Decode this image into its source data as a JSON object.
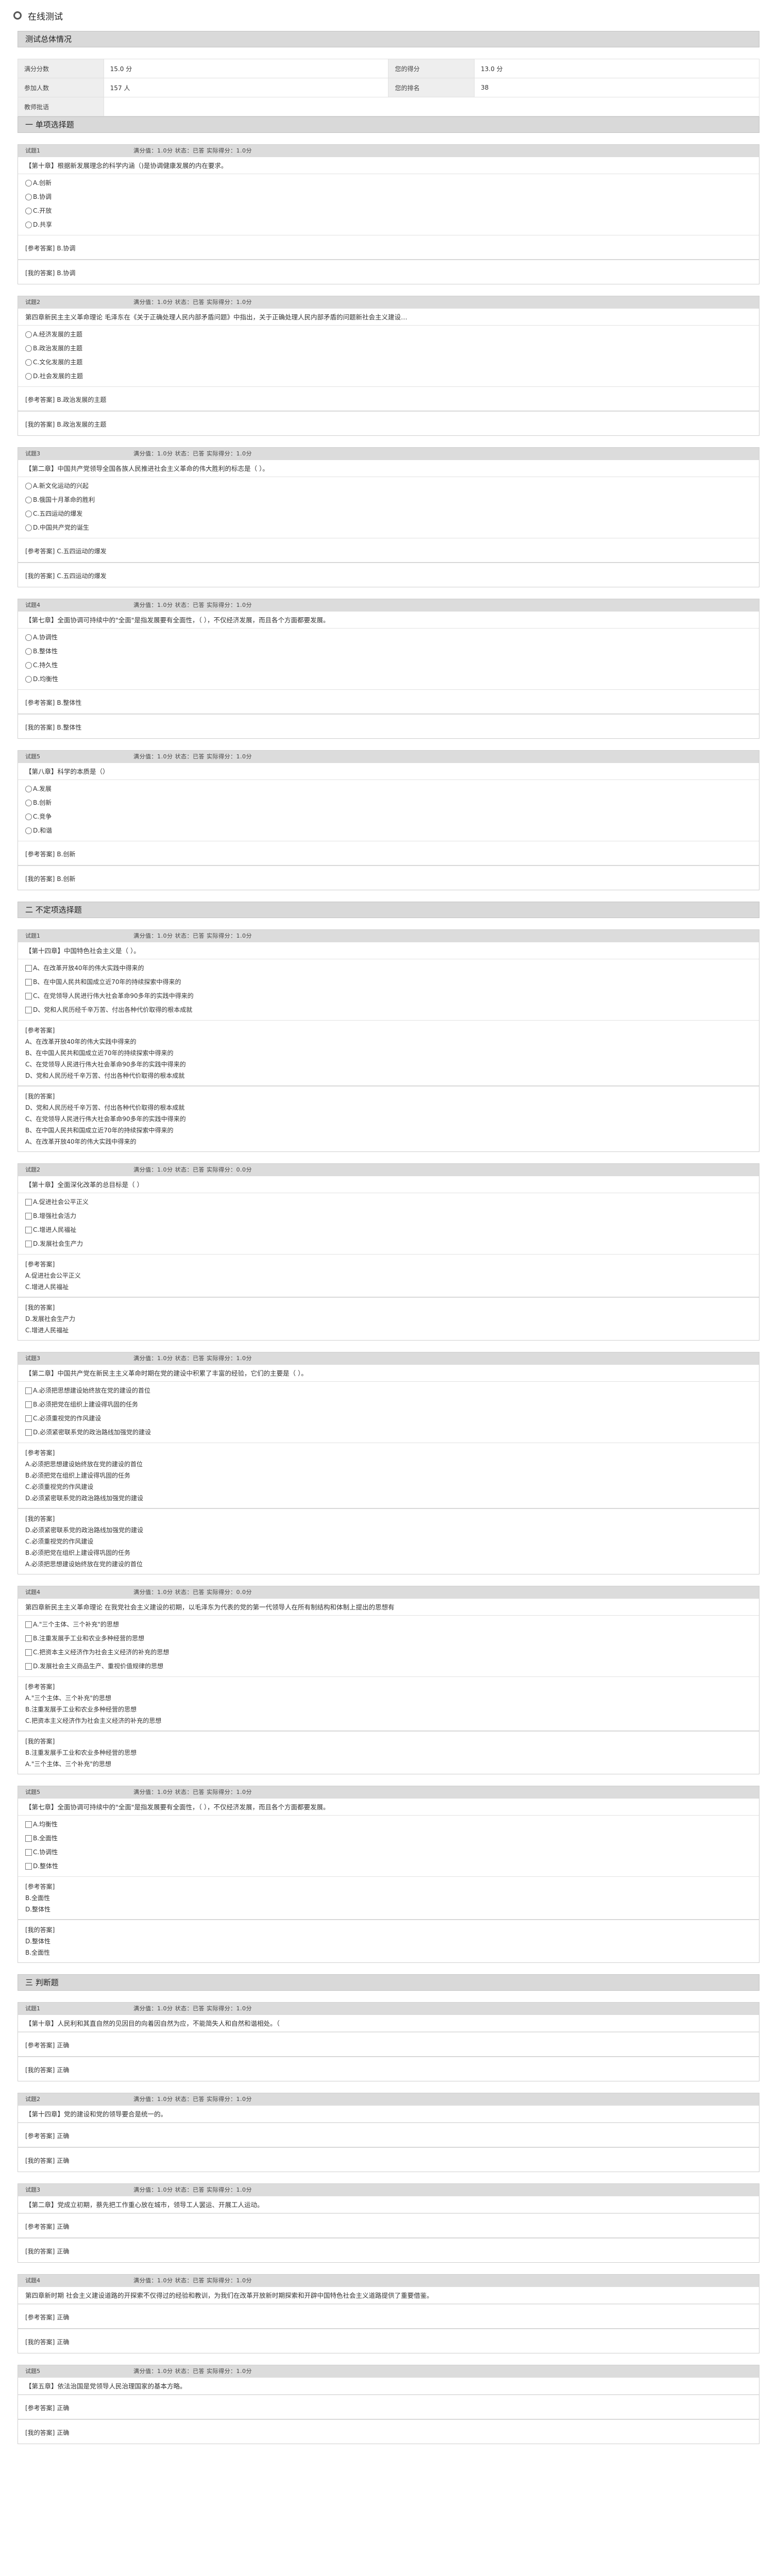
{
  "page_title": "在线测试",
  "summary": {
    "title": "测试总体情况",
    "rows": [
      [
        {
          "k": "满分分数",
          "v": "15.0 分"
        },
        {
          "k": "您的得分",
          "v": "13.0 分"
        }
      ],
      [
        {
          "k": "参加人数",
          "v": "157 人"
        },
        {
          "k": "您的排名",
          "v": "38"
        }
      ],
      [
        {
          "k": "教师批语",
          "v": ""
        }
      ]
    ]
  },
  "labels": {
    "ref": "[参考答案]",
    "mine": "[我的答案]"
  },
  "sections": [
    {
      "title": "一 单项选择题",
      "questions": [
        {
          "no": "试题1",
          "meta": "满分值：1.0分  状态：已答  实际得分：1.0分",
          "text": "【第十章】根据新发展理念的科学内涵（)是协调健康发展的内在要求。",
          "type": "radio",
          "options": [
            "A.创新",
            "B.协调",
            "C.开放",
            "D.共享"
          ],
          "ref": [
            "B.协调"
          ],
          "mine": [
            "B.协调"
          ]
        },
        {
          "no": "试题2",
          "meta": "满分值：1.0分  状态：已答  实际得分：1.0分",
          "text": "第四章新民主主义革命理论 毛泽东在《关于正确处理人民内部矛盾问题》中指出，关于正确处理人民内部矛盾的问题新社会主义建设…",
          "type": "radio",
          "options": [
            "A.经济发展的主题",
            "B.政治发展的主题",
            "C.文化发展的主题",
            "D.社会发展的主题"
          ],
          "ref": [
            "B.政治发展的主题"
          ],
          "mine": [
            "B.政治发展的主题"
          ]
        },
        {
          "no": "试题3",
          "meta": "满分值：1.0分  状态：已答  实际得分：1.0分",
          "text": "【第二章】中国共产党领导全国各族人民推进社会主义革命的伟大胜利的标志是（ ）。",
          "type": "radio",
          "options": [
            "A.新文化运动的兴起",
            "B.俄国十月革命的胜利",
            "C.五四运动的爆发",
            "D.中国共产党的诞生"
          ],
          "ref": [
            "C.五四运动的爆发"
          ],
          "mine": [
            "C.五四运动的爆发"
          ]
        },
        {
          "no": "试题4",
          "meta": "满分值：1.0分  状态：已答  实际得分：1.0分",
          "text": "【第七章】全面协调可持续中的\"全面\"是指发展要有全面性，（ ），不仅经济发展，而且各个方面都要发展。",
          "type": "radio",
          "options": [
            "A.协调性",
            "B.整体性",
            "C.持久性",
            "D.均衡性"
          ],
          "ref": [
            "B.整体性"
          ],
          "mine": [
            "B.整体性"
          ]
        },
        {
          "no": "试题5",
          "meta": "满分值：1.0分  状态：已答  实际得分：1.0分",
          "text": "【第八章】科学的本质是（）",
          "type": "radio",
          "options": [
            "A.发展",
            "B.创新",
            "C.竞争",
            "D.和谐"
          ],
          "ref": [
            "B.创新"
          ],
          "mine": [
            "B.创新"
          ]
        }
      ]
    },
    {
      "title": "二 不定项选择题",
      "questions": [
        {
          "no": "试题1",
          "meta": "满分值：1.0分  状态：已答  实际得分：1.0分",
          "text": "【第十四章】中国特色社会主义是（ ）。",
          "type": "box",
          "options": [
            "A、在改革开放40年的伟大实践中得来的",
            "B、在中国人民共和国成立近70年的持续探索中得来的",
            "C、在党领导人民进行伟大社会革命90多年的实践中得来的",
            "D、党和人民历经千辛万苦、付出各种代价取得的根本成就"
          ],
          "ref": [
            "A、在改革开放40年的伟大实践中得来的",
            "B、在中国人民共和国成立近70年的持续探索中得来的",
            "C、在党领导人民进行伟大社会革命90多年的实践中得来的",
            "D、党和人民历经千辛万苦、付出各种代价取得的根本成就"
          ],
          "mine": [
            "D、党和人民历经千辛万苦、付出各种代价取得的根本成就",
            "C、在党领导人民进行伟大社会革命90多年的实践中得来的",
            "B、在中国人民共和国成立近70年的持续探索中得来的",
            "A、在改革开放40年的伟大实践中得来的"
          ]
        },
        {
          "no": "试题2",
          "meta": "满分值：1.0分  状态：已答  实际得分：0.0分",
          "text": "【第十章】全面深化改革的总目标是（ ）",
          "type": "box",
          "options": [
            "A.促进社会公平正义",
            "B.增强社会活力",
            "C.增进人民福祉",
            "D.发展社会生产力"
          ],
          "ref": [
            "A.促进社会公平正义",
            "C.增进人民福祉"
          ],
          "mine": [
            "D.发展社会生产力",
            "C.增进人民福祉"
          ]
        },
        {
          "no": "试题3",
          "meta": "满分值：1.0分  状态：已答  实际得分：1.0分",
          "text": "【第二章】中国共产党在新民主主义革命时期在党的建设中积累了丰富的经验，它们的主要是（ ）。",
          "type": "box",
          "options": [
            "A.必须把思想建设始终放在党的建设的首位",
            "B.必须把党在组织上建设得巩固的任务",
            "C.必须重视党的作风建设",
            "D.必须紧密联系党的政治路线加强党的建设"
          ],
          "ref": [
            "A.必须把思想建设始终放在党的建设的首位",
            "B.必须把党在组织上建设得巩固的任务",
            "C.必须重视党的作风建设",
            "D.必须紧密联系党的政治路线加强党的建设"
          ],
          "mine": [
            "D.必须紧密联系党的政治路线加强党的建设",
            "C.必须重视党的作风建设",
            "B.必须把党在组织上建设得巩固的任务",
            "A.必须把思想建设始终放在党的建设的首位"
          ]
        },
        {
          "no": "试题4",
          "meta": "满分值：1.0分  状态：已答  实际得分：0.0分",
          "text": "第四章新民主主义革命理论 在我党社会主义建设的初期，以毛泽东为代表的党的第一代领导人在所有制结构和体制上提出的思想有",
          "type": "box",
          "options": [
            "A.\"三个主体、三个补充\"的思想",
            "B.注重发展手工业和农业多种经营的思想",
            "C.把资本主义经济作为社会主义经济的补充的思想",
            "D.发展社会主义商品生产、重视价值规律的思想"
          ],
          "ref": [
            "A.\"三个主体、三个补充\"的思想",
            "B.注重发展手工业和农业多种经营的思想",
            "C.把资本主义经济作为社会主义经济的补充的思想"
          ],
          "mine": [
            "B.注重发展手工业和农业多种经营的思想",
            "A.\"三个主体、三个补充\"的思想"
          ]
        },
        {
          "no": "试题5",
          "meta": "满分值：1.0分  状态：已答  实际得分：1.0分",
          "text": "【第七章】全面协调可持续中的\"全面\"是指发展要有全面性，（ ），不仅经济发展，而且各个方面都要发展。",
          "type": "box",
          "options": [
            "A.均衡性",
            "B.全面性",
            "C.协调性",
            "D.整体性"
          ],
          "ref": [
            "B.全面性",
            "D.整体性"
          ],
          "mine": [
            "D.整体性",
            "B.全面性"
          ]
        }
      ]
    },
    {
      "title": "三 判断题",
      "questions": [
        {
          "no": "试题1",
          "meta": "满分值：1.0分  状态：已答  实际得分：1.0分",
          "text": "【第十章】人民利和其直自然的见因目的向着因自然为应，不能简失人和自然和谐相处。（",
          "type": "none",
          "options": [],
          "ref": [
            "正确"
          ],
          "mine": [
            "正确"
          ]
        },
        {
          "no": "试题2",
          "meta": "满分值：1.0分  状态：已答  实际得分：1.0分",
          "text": "【第十四章】党的建设和党的领导要合是统一的。",
          "type": "none",
          "options": [],
          "ref": [
            "正确"
          ],
          "mine": [
            "正确"
          ]
        },
        {
          "no": "试题3",
          "meta": "满分值：1.0分  状态：已答  实际得分：1.0分",
          "text": "【第二章】党成立初期，蔡先把工作重心放在城市，领导工人罢运、开展工人运动。",
          "type": "none",
          "options": [],
          "ref": [
            "正确"
          ],
          "mine": [
            "正确"
          ]
        },
        {
          "no": "试题4",
          "meta": "满分值：1.0分  状态：已答  实际得分：1.0分",
          "text": "第四章新时期 社会主义建设道路的开探索不仅得过的经验和教训，为我们在改革开放新时期探索和开辟中国特色社会主义道路提供了重要借鉴。",
          "type": "none",
          "options": [],
          "ref": [
            "正确"
          ],
          "mine": [
            "正确"
          ]
        },
        {
          "no": "试题5",
          "meta": "满分值：1.0分  状态：已答  实际得分：1.0分",
          "text": "【第五章】依法治国是党领导人民治理国家的基本方略。",
          "type": "none",
          "options": [],
          "ref": [
            "正确"
          ],
          "mine": [
            "正确"
          ]
        }
      ]
    }
  ]
}
